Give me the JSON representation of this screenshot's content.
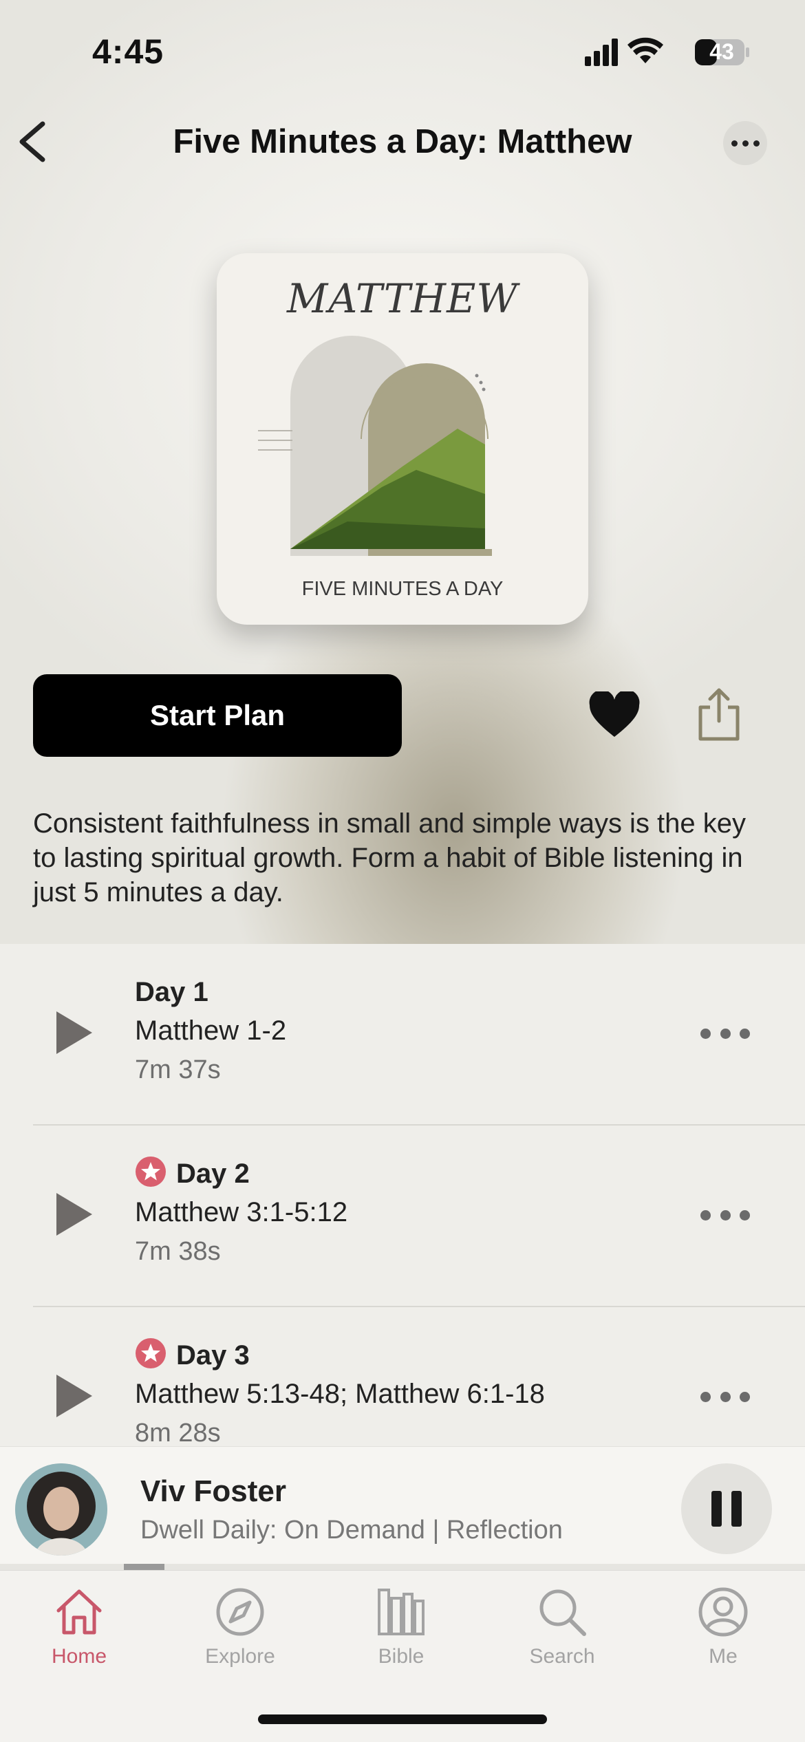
{
  "status_bar": {
    "time": "4:45",
    "battery": "43"
  },
  "header": {
    "title": "Five Minutes a Day: Matthew"
  },
  "cover": {
    "title": "MATTHEW",
    "subtitle": "FIVE MINUTES A DAY"
  },
  "actions": {
    "start_label": "Start Plan"
  },
  "description": "Consistent faithfulness in small and simple ways is the key to lasting spiritual growth. Form a habit of Bible listening in just 5 minutes a day.",
  "days": [
    {
      "day": "Day 1",
      "reference": "Matthew 1-2",
      "duration": "7m 37s",
      "starred": false
    },
    {
      "day": "Day 2",
      "reference": "Matthew 3:1-5:12",
      "duration": "7m 38s",
      "starred": true
    },
    {
      "day": "Day 3",
      "reference": "Matthew 5:13-48; Matthew 6:1-18",
      "duration": "8m 28s",
      "starred": true
    }
  ],
  "player": {
    "name": "Viv Foster",
    "subtitle": "Dwell Daily: On Demand | Reflection",
    "progress": 0.05
  },
  "tabs": [
    {
      "label": "Home",
      "icon": "home-icon",
      "active": true
    },
    {
      "label": "Explore",
      "icon": "compass-icon",
      "active": false
    },
    {
      "label": "Bible",
      "icon": "bible-icon",
      "active": false
    },
    {
      "label": "Search",
      "icon": "search-icon",
      "active": false
    },
    {
      "label": "Me",
      "icon": "profile-icon",
      "active": false
    }
  ],
  "colors": {
    "accent": "#c8576a",
    "button": "#000000",
    "star": "#d95f6e"
  }
}
